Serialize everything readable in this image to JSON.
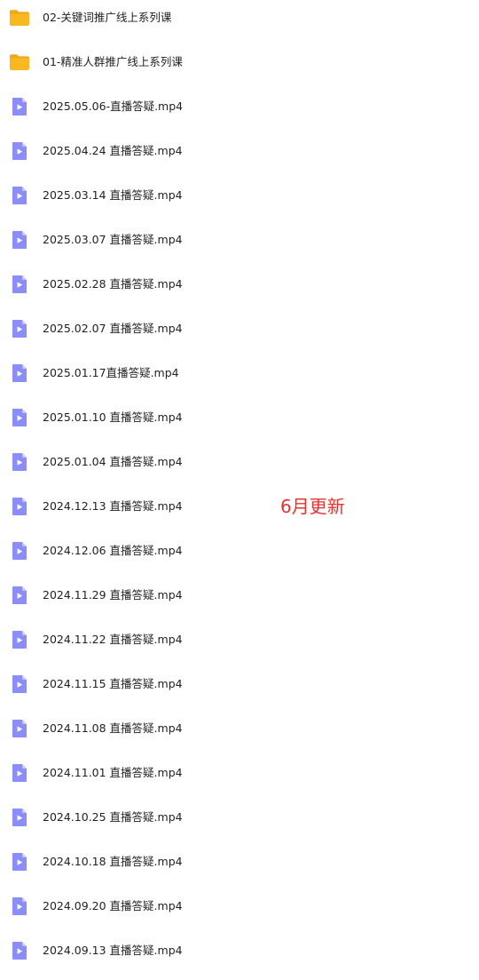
{
  "files": [
    {
      "type": "folder",
      "icon": "folder-icon",
      "name": "02-关键词推广线上系列课"
    },
    {
      "type": "folder",
      "icon": "folder-icon",
      "name": "01-精准人群推广线上系列课"
    },
    {
      "type": "video",
      "icon": "video-file-icon",
      "name": "2025.05.06-直播答疑.mp4"
    },
    {
      "type": "video",
      "icon": "video-file-icon",
      "name": "2025.04.24 直播答疑.mp4"
    },
    {
      "type": "video",
      "icon": "video-file-icon",
      "name": "2025.03.14 直播答疑.mp4"
    },
    {
      "type": "video",
      "icon": "video-file-icon",
      "name": "2025.03.07 直播答疑.mp4"
    },
    {
      "type": "video",
      "icon": "video-file-icon",
      "name": "2025.02.28 直播答疑.mp4"
    },
    {
      "type": "video",
      "icon": "video-file-icon",
      "name": "2025.02.07 直播答疑.mp4"
    },
    {
      "type": "video",
      "icon": "video-file-icon",
      "name": "2025.01.17直播答疑.mp4"
    },
    {
      "type": "video",
      "icon": "video-file-icon",
      "name": "2025.01.10 直播答疑.mp4"
    },
    {
      "type": "video",
      "icon": "video-file-icon",
      "name": "2025.01.04 直播答疑.mp4"
    },
    {
      "type": "video",
      "icon": "video-file-icon",
      "name": "2024.12.13 直播答疑.mp4"
    },
    {
      "type": "video",
      "icon": "video-file-icon",
      "name": "2024.12.06 直播答疑.mp4"
    },
    {
      "type": "video",
      "icon": "video-file-icon",
      "name": "2024.11.29 直播答疑.mp4"
    },
    {
      "type": "video",
      "icon": "video-file-icon",
      "name": "2024.11.22 直播答疑.mp4"
    },
    {
      "type": "video",
      "icon": "video-file-icon",
      "name": "2024.11.15 直播答疑.mp4"
    },
    {
      "type": "video",
      "icon": "video-file-icon",
      "name": "2024.11.08 直播答疑.mp4"
    },
    {
      "type": "video",
      "icon": "video-file-icon",
      "name": "2024.11.01 直播答疑.mp4"
    },
    {
      "type": "video",
      "icon": "video-file-icon",
      "name": "2024.10.25 直播答疑.mp4"
    },
    {
      "type": "video",
      "icon": "video-file-icon",
      "name": "2024.10.18 直播答疑.mp4"
    },
    {
      "type": "video",
      "icon": "video-file-icon",
      "name": "2024.09.20 直播答疑.mp4"
    },
    {
      "type": "video",
      "icon": "video-file-icon",
      "name": "2024.09.13 直播答疑.mp4"
    }
  ],
  "annotation": {
    "text": "6月更新",
    "color": "#e8322c"
  },
  "colors": {
    "folder": "#f9b820",
    "folder_tab": "#f3a712",
    "video": "#8b8dfb",
    "text": "#222222"
  }
}
